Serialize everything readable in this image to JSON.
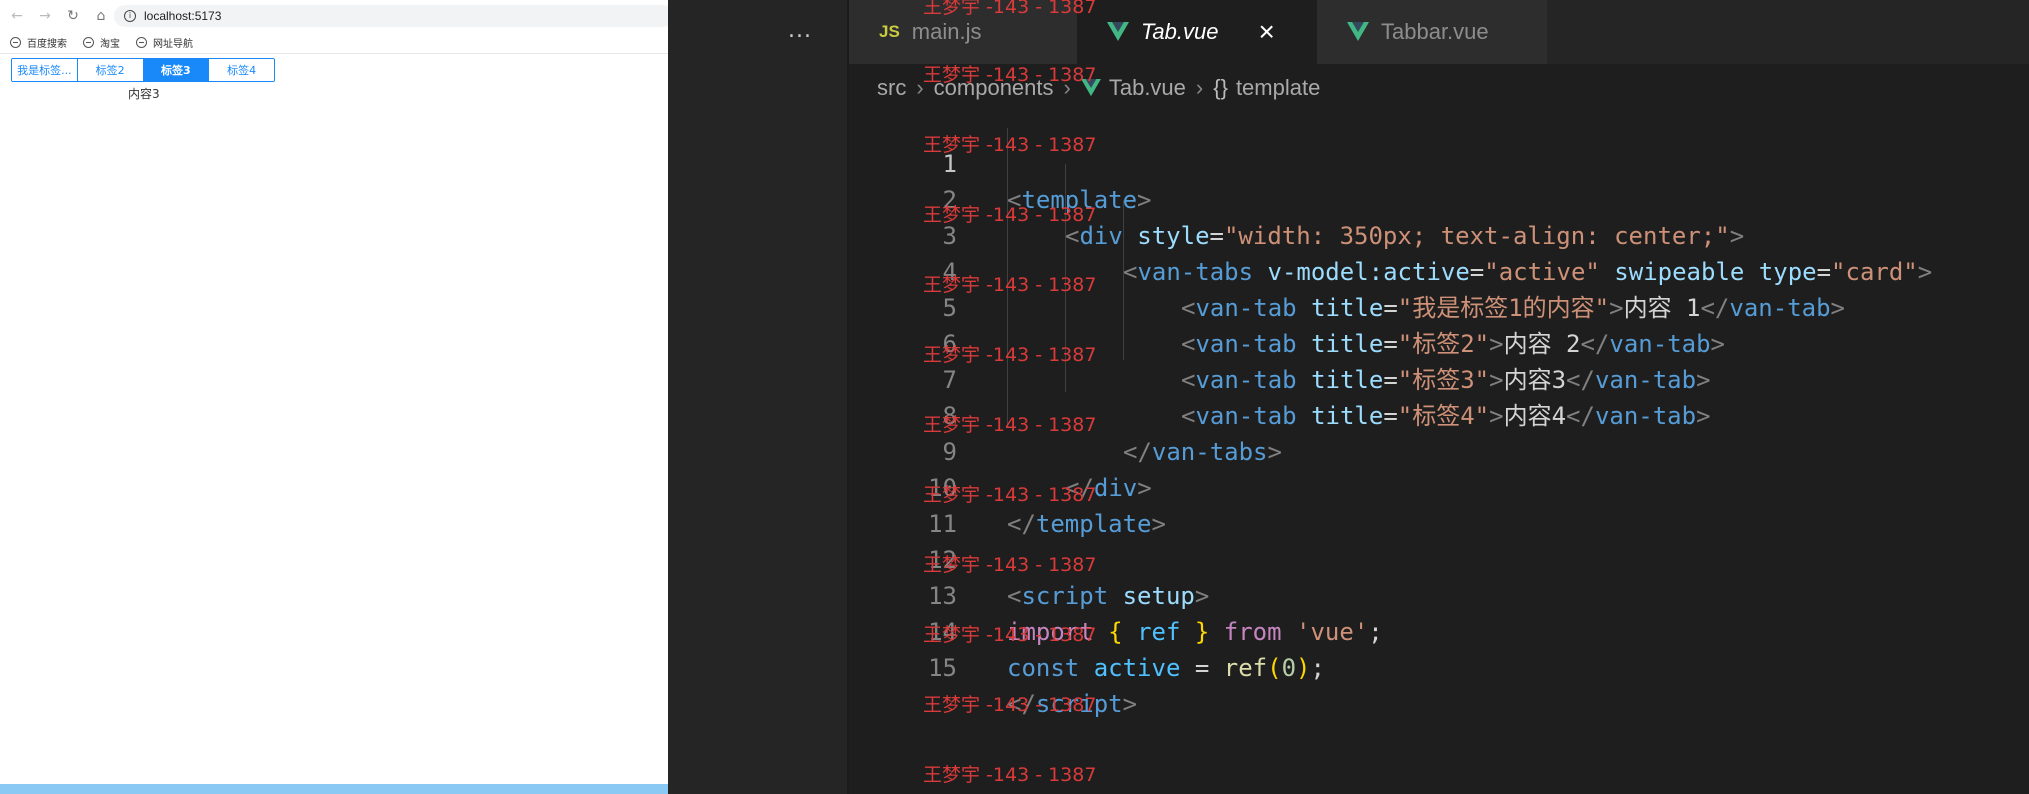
{
  "browser": {
    "url": "localhost:5173",
    "bookmarks": [
      {
        "label": "百度搜索"
      },
      {
        "label": "淘宝"
      },
      {
        "label": "网址导航"
      }
    ],
    "tabs": [
      {
        "label": "我是标签..."
      },
      {
        "label": "标签2"
      },
      {
        "label": "标签3"
      },
      {
        "label": "标签4"
      }
    ],
    "active_tab": 2,
    "content": "内容3"
  },
  "editor": {
    "more_icon": "...",
    "tabs": [
      {
        "label": "main.js",
        "icon": "JS"
      },
      {
        "label": "Tab.vue",
        "icon": "vue-icon"
      },
      {
        "label": "Tabbar.vue",
        "icon": "vue-icon"
      }
    ],
    "close_glyph": "×",
    "breadcrumb": [
      "src",
      "components",
      "Tab.vue",
      "template"
    ],
    "breadcrumb_braces": "{}",
    "line_numbers": [
      "1",
      "2",
      "3",
      "4",
      "5",
      "6",
      "7",
      "8",
      "9",
      "10",
      "11",
      "12",
      "13",
      "14",
      "15"
    ],
    "code": {
      "l1_tag": "template",
      "l2_tag": "div",
      "l2_attr": "style",
      "l2_val": "\"width: 350px; text-align: center;\"",
      "l3_tag": "van-tabs",
      "l3_attr1": "v-model:active",
      "l3_val1": "\"active\"",
      "l3_attr2": "swipeable",
      "l3_attr3": "type",
      "l3_val3": "\"card\"",
      "l4_tag": "van-tab",
      "l4_attr": "title",
      "l4_val": "\"我是标签1的内容\"",
      "l4_text": "内容 1",
      "l5_tag": "van-tab",
      "l5_attr": "title",
      "l5_val": "\"标签2\"",
      "l5_text": "内容 2",
      "l6_tag": "van-tab",
      "l6_attr": "title",
      "l6_val": "\"标签3\"",
      "l6_text": "内容3",
      "l7_tag": "van-tab",
      "l7_attr": "title",
      "l7_val": "\"标签4\"",
      "l7_text": "内容4",
      "l8_tag": "van-tabs",
      "l9_tag": "div",
      "l10_tag": "template",
      "l12_tag": "script",
      "l12_attr": "setup",
      "l13_import": "import",
      "l13_name": "ref",
      "l13_from": "from",
      "l13_module": "'vue'",
      "l14_const": "const",
      "l14_var": "active",
      "l14_fn": "ref",
      "l14_num": "0",
      "l15_tag": "script"
    }
  },
  "watermark": "王梦宇 -143 - 1387",
  "colors": {
    "vant_blue": "#1989fa",
    "editor_bg": "#1e1e1e",
    "watermark": "#d93a3a"
  }
}
